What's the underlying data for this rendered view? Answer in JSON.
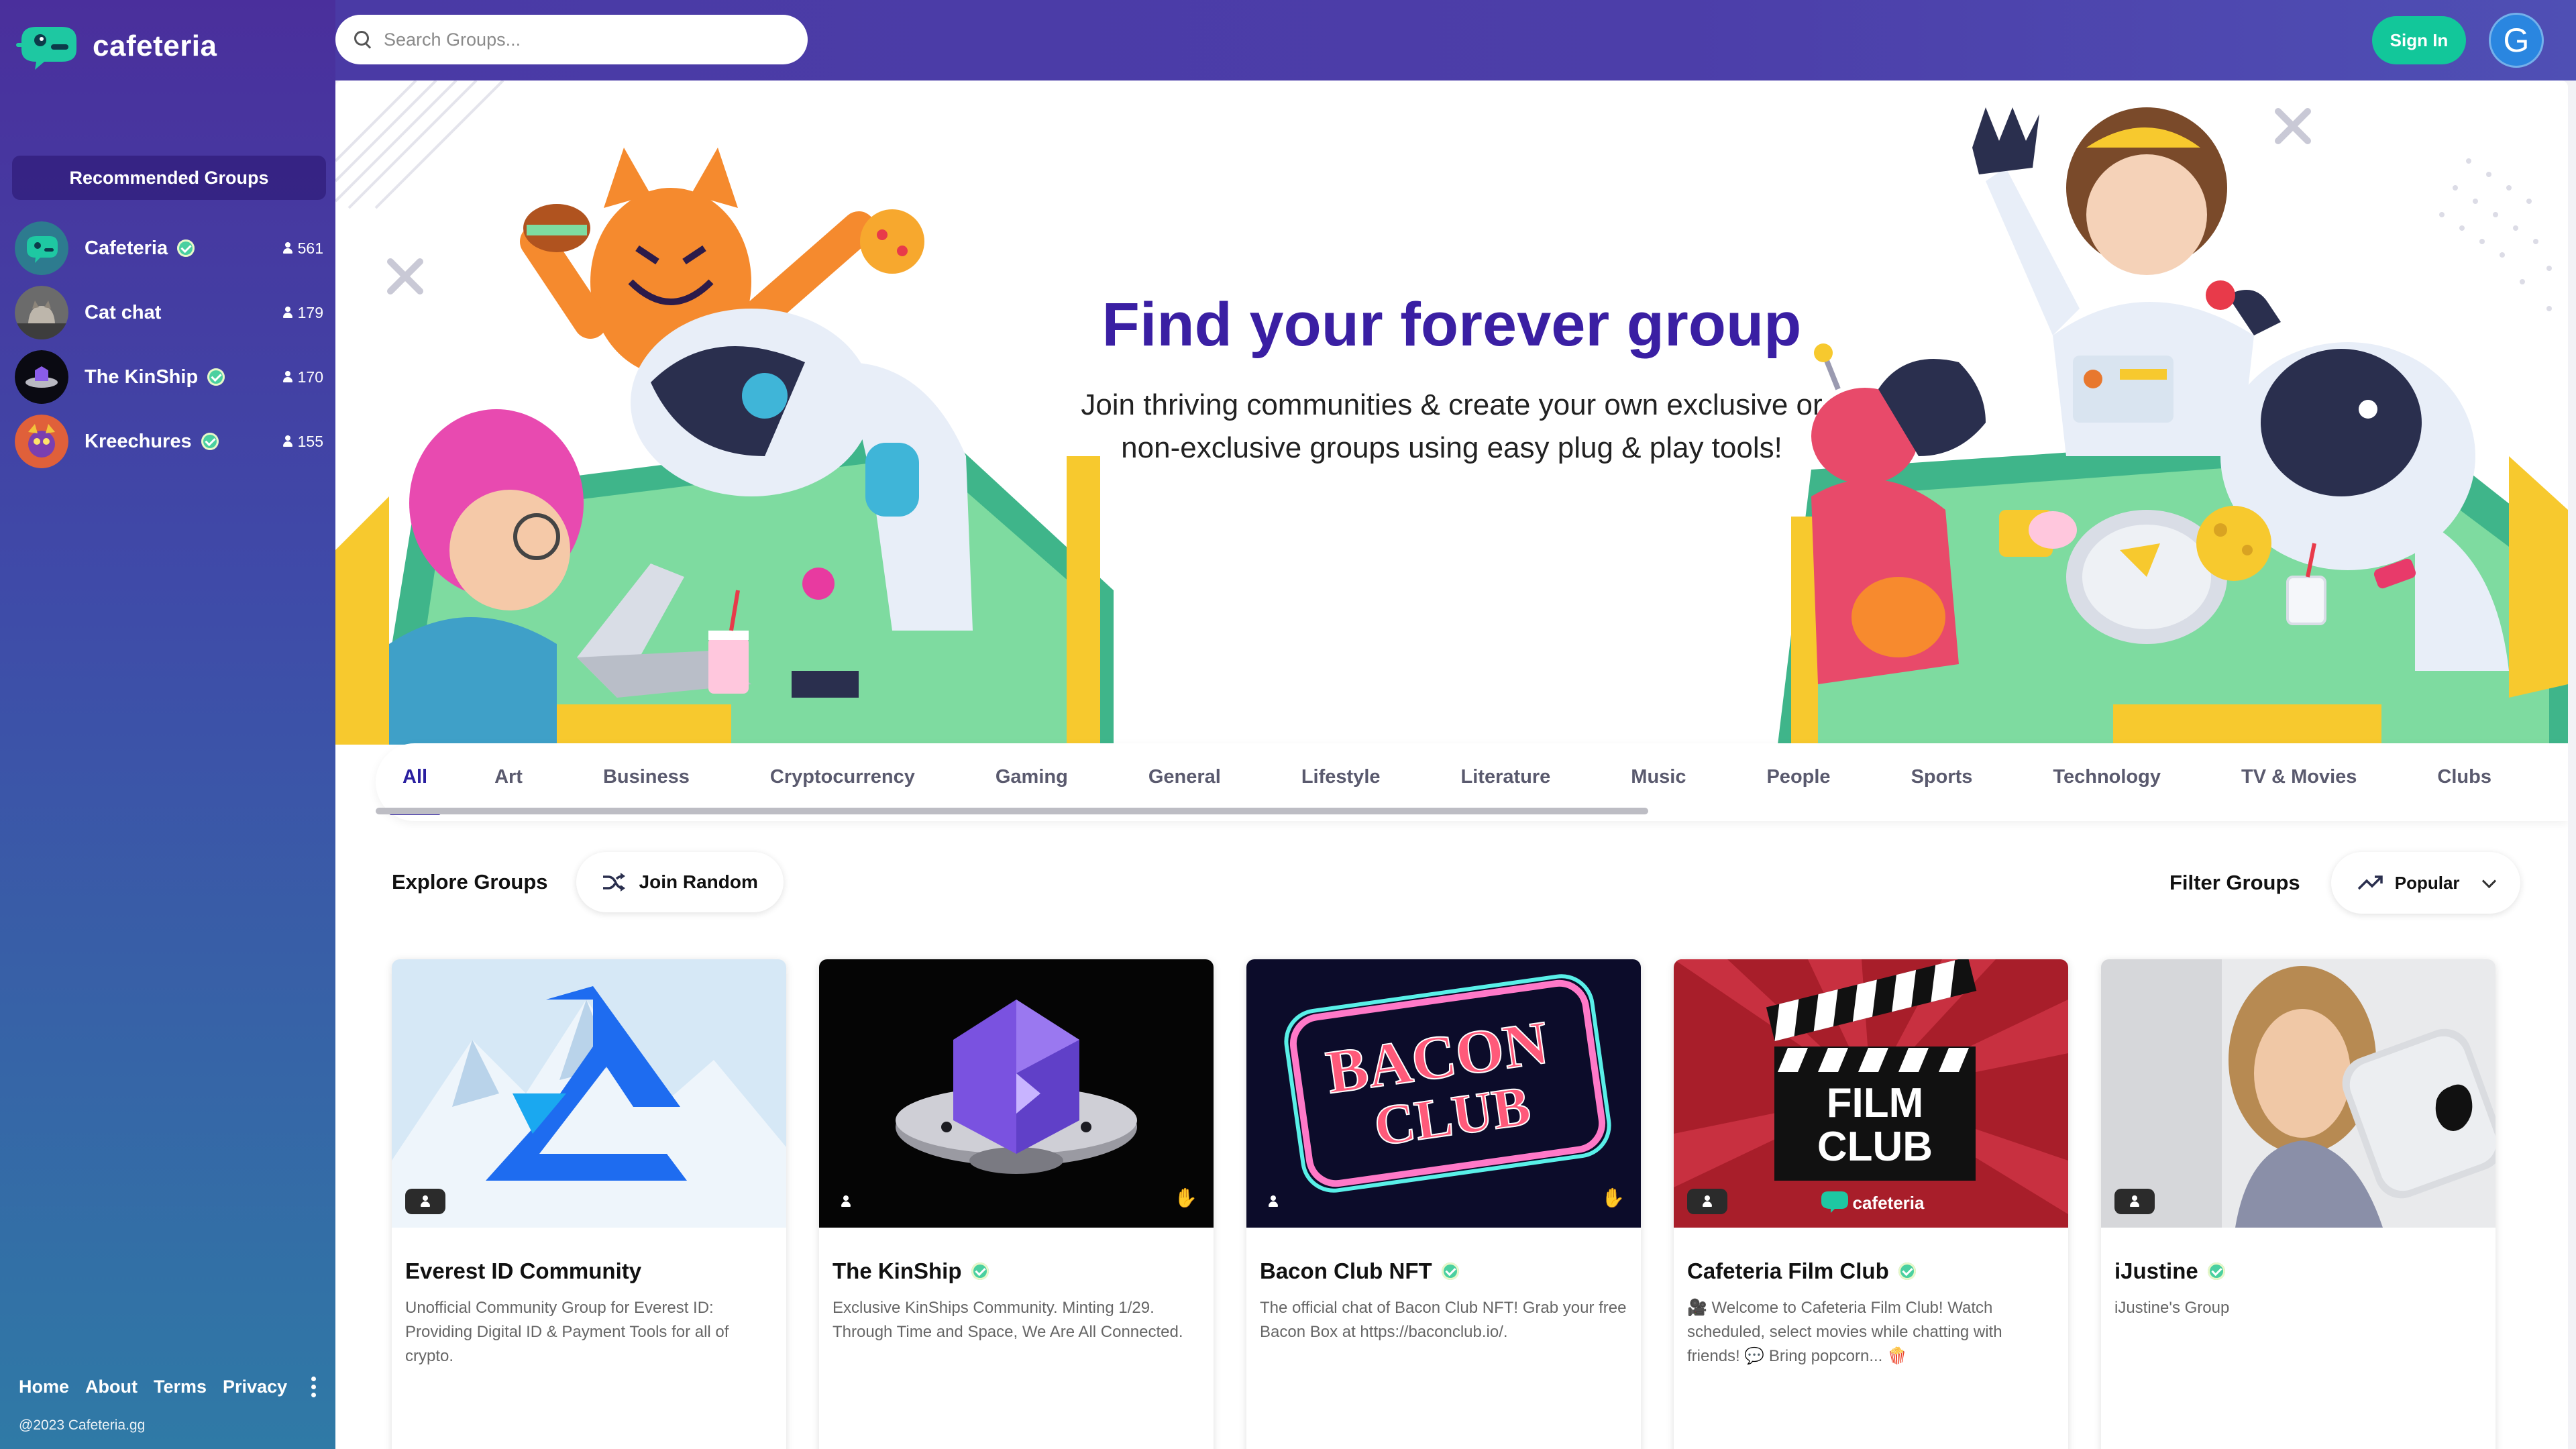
{
  "app": {
    "name": "cafeteria"
  },
  "search": {
    "placeholder": "Search Groups..."
  },
  "header": {
    "signin_label": "Sign In",
    "avatar_letter": "G"
  },
  "sidebar": {
    "recommended_title": "Recommended Groups",
    "items": [
      {
        "name": "Cafeteria",
        "verified": true,
        "members": "561"
      },
      {
        "name": "Cat chat",
        "verified": false,
        "members": "179"
      },
      {
        "name": "The KinShip",
        "verified": true,
        "members": "170"
      },
      {
        "name": "Kreechures",
        "verified": true,
        "members": "155"
      }
    ],
    "footer": {
      "home": "Home",
      "about": "About",
      "terms": "Terms",
      "privacy": "Privacy",
      "copyright": "@2023 Cafeteria.gg"
    }
  },
  "hero": {
    "title": "Find your forever group",
    "subtitle_line1": "Join thriving communities & create your own exclusive or",
    "subtitle_line2": "non-exclusive groups using easy plug & play tools!"
  },
  "tabs": [
    "All",
    "Art",
    "Business",
    "Cryptocurrency",
    "Gaming",
    "General",
    "Lifestyle",
    "Literature",
    "Music",
    "People",
    "Sports",
    "Technology",
    "TV & Movies",
    "Clubs"
  ],
  "active_tab": "All",
  "explore": {
    "title": "Explore Groups",
    "join_random": "Join Random"
  },
  "filter": {
    "title": "Filter Groups",
    "selected": "Popular"
  },
  "cards": [
    {
      "name": "Everest ID Community",
      "verified": false,
      "desc": "Unofficial Community Group for Everest ID: Providing Digital ID & Payment Tools for all of crypto."
    },
    {
      "name": "The KinShip",
      "verified": true,
      "desc": "Exclusive KinShips Community. Minting 1/29. Through Time and Space, We Are All Connected."
    },
    {
      "name": "Bacon Club NFT",
      "verified": true,
      "desc": "The official chat of Bacon Club NFT! Grab your free Bacon Box at https://baconclub.io/."
    },
    {
      "name": "Cafeteria Film Club",
      "verified": true,
      "desc": "🎥 Welcome to Cafeteria Film Club! Watch scheduled, select movies while chatting with friends! 💬 Bring popcorn... 🍿"
    },
    {
      "name": "iJustine",
      "verified": true,
      "desc": "iJustine's Group"
    }
  ],
  "card_art": {
    "bacon_line1": "BACON",
    "bacon_line2": "CLUB",
    "film_line1": "FILM",
    "film_line2": "CLUB",
    "film_brand": "cafeteria"
  },
  "colors": {
    "accent": "#3a1fa3",
    "signin": "#12c79a",
    "avatar": "#2a86e0"
  }
}
